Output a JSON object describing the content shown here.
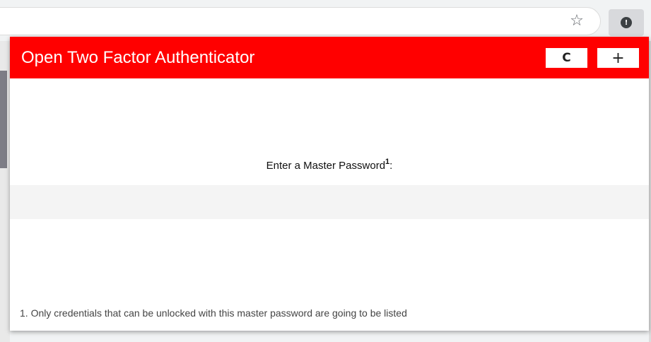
{
  "browser": {
    "star_glyph": "☆",
    "extension_glyph": "!"
  },
  "popup": {
    "title": "Open Two Factor Authenticator",
    "header_color": "#ff0000",
    "refresh_glyph": "C",
    "add_glyph": "+",
    "prompt_text": "Enter a Master Password",
    "prompt_sup": "1",
    "prompt_suffix": ":",
    "password_value": "",
    "footnote": "1. Only credentials that can be unlocked with this master password are going to be listed"
  }
}
